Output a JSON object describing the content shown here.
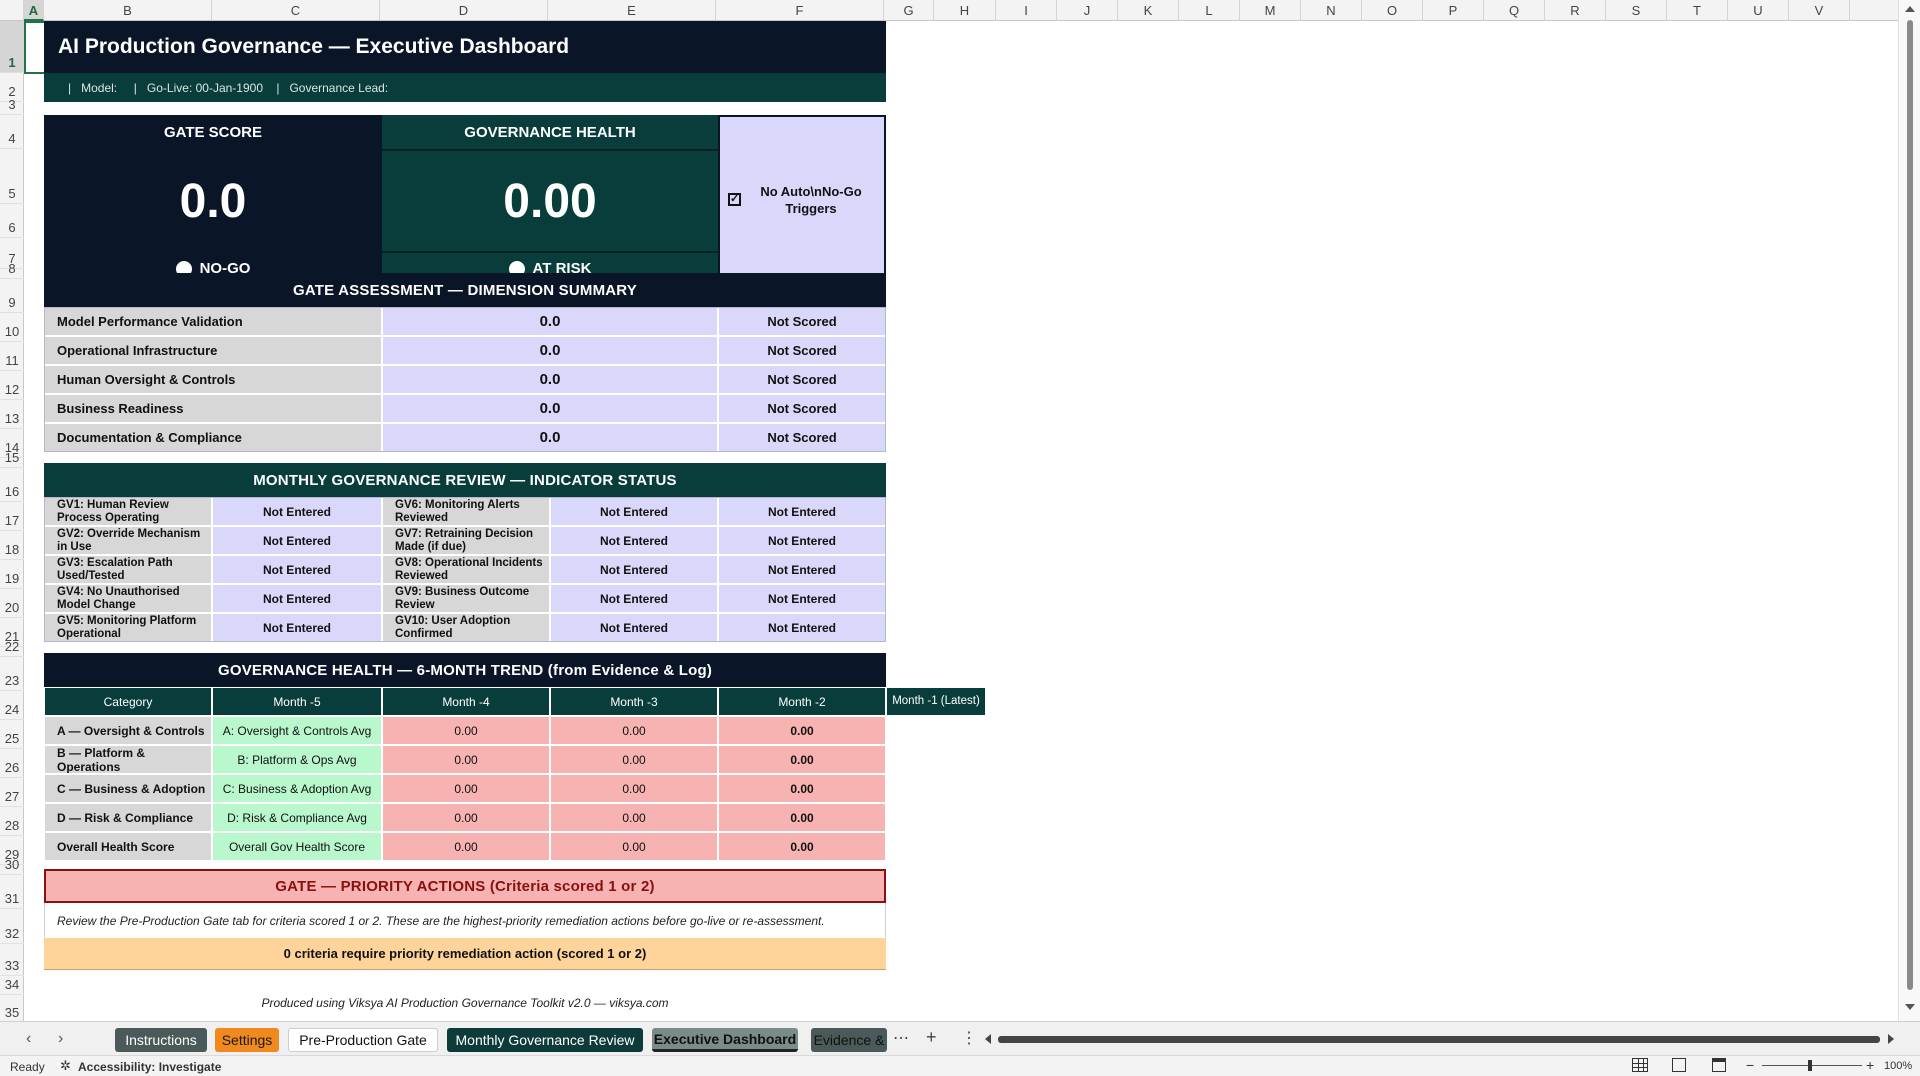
{
  "columns": [
    "A",
    "B",
    "C",
    "D",
    "E",
    "F",
    "G",
    "H",
    "I",
    "J",
    "K",
    "L",
    "M",
    "N",
    "O",
    "P",
    "Q",
    "R",
    "S",
    "T",
    "U",
    "V"
  ],
  "rows": [
    "1",
    "2",
    "3",
    "4",
    "5",
    "6",
    "7",
    "8",
    "9",
    "10",
    "11",
    "12",
    "13",
    "14",
    "15",
    "16",
    "17",
    "18",
    "19",
    "20",
    "21",
    "22",
    "23",
    "24",
    "25",
    "26",
    "27",
    "28",
    "29",
    "30",
    "31",
    "32",
    "33",
    "34",
    "35"
  ],
  "header": {
    "title": "AI Production Governance — Executive Dashboard",
    "meta": "|   Model:     |   Go-Live: 00-Jan-1900    |   Governance Lead:"
  },
  "kpi": {
    "gate_label": "GATE SCORE",
    "gate_value": "0.0",
    "gate_status": "NO-GO",
    "health_label": "GOVERNANCE HEALTH",
    "health_value": "0.00",
    "health_status": "AT RISK",
    "trigger_text": "No Auto\\nNo-Go Triggers"
  },
  "gate_assessment": {
    "title": "GATE ASSESSMENT — DIMENSION SUMMARY",
    "rows": [
      {
        "label": "Model Performance Validation",
        "score": "0.0",
        "status": "Not Scored"
      },
      {
        "label": "Operational Infrastructure",
        "score": "0.0",
        "status": "Not Scored"
      },
      {
        "label": "Human Oversight & Controls",
        "score": "0.0",
        "status": "Not Scored"
      },
      {
        "label": "Business Readiness",
        "score": "0.0",
        "status": "Not Scored"
      },
      {
        "label": "Documentation & Compliance",
        "score": "0.0",
        "status": "Not Scored"
      }
    ]
  },
  "monthly_review": {
    "title": "MONTHLY GOVERNANCE REVIEW — INDICATOR STATUS",
    "rows": [
      {
        "left": "GV1: Human Review Process Operating",
        "left_status": "Not Entered",
        "right": "GV6: Monitoring Alerts Reviewed",
        "right_status": "Not Entered",
        "extra": "Not Entered"
      },
      {
        "left": "GV2: Override Mechanism in Use",
        "left_status": "Not Entered",
        "right": "GV7: Retraining Decision Made (if due)",
        "right_status": "Not Entered",
        "extra": "Not Entered"
      },
      {
        "left": "GV3: Escalation Path Used/Tested",
        "left_status": "Not Entered",
        "right": "GV8: Operational Incidents Reviewed",
        "right_status": "Not Entered",
        "extra": "Not Entered"
      },
      {
        "left": "GV4: No Unauthorised Model Change",
        "left_status": "Not Entered",
        "right": "GV9: Business Outcome Review",
        "right_status": "Not Entered",
        "extra": "Not Entered"
      },
      {
        "left": "GV5: Monitoring Platform Operational",
        "left_status": "Not Entered",
        "right": "GV10: User Adoption Confirmed",
        "right_status": "Not Entered",
        "extra": "Not Entered"
      }
    ]
  },
  "trend": {
    "title": "GOVERNANCE HEALTH — 6-MONTH TREND (from Evidence & Log)",
    "headers": [
      "Category",
      "Month -5",
      "Month -4",
      "Month -3",
      "Month -2",
      "Month -1 (Latest)"
    ],
    "rows": [
      {
        "category": "A — Oversight & Controls",
        "m5": "A: Oversight & Controls Avg",
        "m4": "0.00",
        "m3": "0.00",
        "m2": "0.00"
      },
      {
        "category": "B — Platform & Operations",
        "m5": "B: Platform & Ops Avg",
        "m4": "0.00",
        "m3": "0.00",
        "m2": "0.00"
      },
      {
        "category": "C — Business & Adoption",
        "m5": "C: Business & Adoption Avg",
        "m4": "0.00",
        "m3": "0.00",
        "m2": "0.00"
      },
      {
        "category": "D — Risk & Compliance",
        "m5": "D: Risk & Compliance Avg",
        "m4": "0.00",
        "m3": "0.00",
        "m2": "0.00"
      },
      {
        "category": "Overall Health Score",
        "m5": "Overall Gov Health Score",
        "m4": "0.00",
        "m3": "0.00",
        "m2": "0.00"
      }
    ]
  },
  "priority": {
    "title": "GATE — PRIORITY ACTIONS (Criteria scored 1 or 2)",
    "note": "Review the Pre-Production Gate tab for criteria scored 1 or 2. These are the highest-priority remediation actions before go-live or re-assessment.",
    "count_text": "0 criteria require priority remediation action (scored 1 or 2)"
  },
  "footer": "Produced using Viksya AI Production Governance Toolkit v2.0 — viksya.com",
  "tabs": [
    {
      "label": "Instructions",
      "bg": "#4a5a5a",
      "fg": "#ffffff"
    },
    {
      "label": "Settings",
      "bg": "#f08a1f",
      "fg": "#1a1a1a"
    },
    {
      "label": "Pre-Production Gate",
      "bg": "#ffffff",
      "fg": "#111111"
    },
    {
      "label": "Monthly Governance Review",
      "bg": "#0d3b3a",
      "fg": "#ffffff"
    },
    {
      "label": "Executive Dashboard",
      "bg": "#7a8c8a",
      "fg": "#111111"
    },
    {
      "label": "Evidence &",
      "bg": "#4a5a5a",
      "fg": "#111111"
    }
  ],
  "status_bar": {
    "ready": "Ready",
    "accessibility": "Accessibility: Investigate",
    "zoom": "100%"
  }
}
